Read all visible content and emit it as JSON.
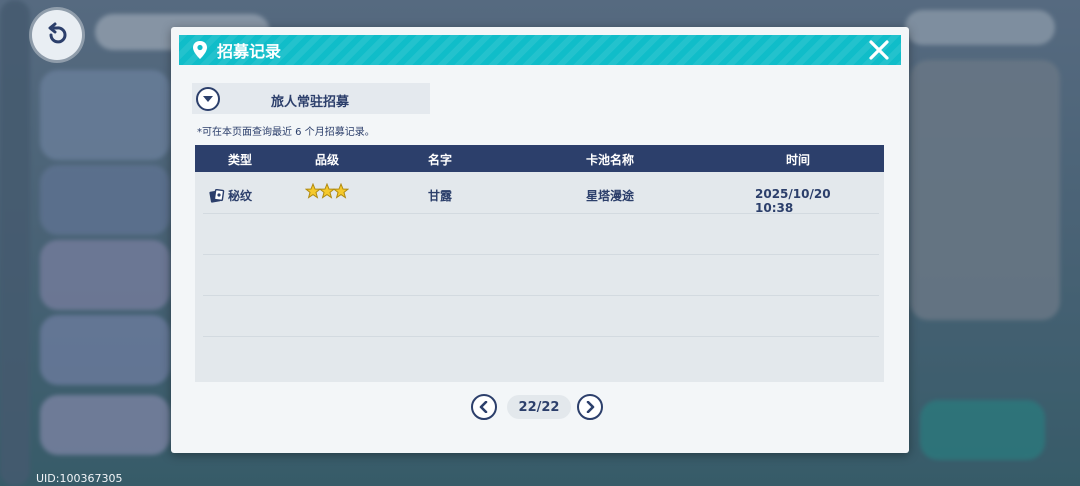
{
  "background": {
    "uid_text": "UID:100367305"
  },
  "modal": {
    "title": "招募记录",
    "banner_selector": {
      "label": "旅人常驻招募"
    },
    "notice": "*可在本页面查询最近 6 个月招募记录。",
    "table": {
      "headers": [
        "类型",
        "品级",
        "名字",
        "卡池名称",
        "时间"
      ],
      "rows": [
        {
          "type": "秘纹",
          "rarity_stars": 3,
          "name": "甘露",
          "pool": "星塔漫途",
          "time": "2025/10/20 10:38"
        }
      ]
    },
    "pagination": {
      "label": "22/22",
      "current": 22,
      "total": 22
    }
  },
  "icons": {
    "header": "location-pin-icon",
    "close": "close-icon",
    "dropdown": "chevron-down-icon",
    "type": "card-icon",
    "rarity": "star-icon",
    "prev": "chevron-left-icon",
    "next": "chevron-right-icon",
    "back": "back-arrow-icon"
  },
  "colors": {
    "header": "#10bdc9",
    "navy": "#2c3f6b",
    "star": "#f5c92c",
    "panel": "#f3f6f8",
    "table_bg": "#e3e8ec"
  }
}
